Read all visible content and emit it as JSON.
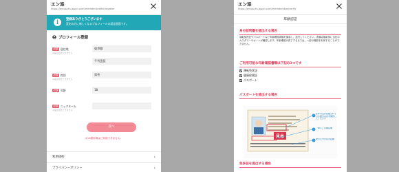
{
  "left_phone": {
    "header": {
      "title": "エン派",
      "url": "https://enjob.en-japan.com/member/profile/register"
    },
    "notice": {
      "title": "登録ありがとうございます",
      "body": "変化の方に新しくなるプロフィールの設定画面です。"
    },
    "section_title": "プロフィール登録",
    "fields": [
      {
        "required": "必須",
        "label": "居住地",
        "sub": "※設定変更できません",
        "values": [
          "東京都",
          "千代田区"
        ]
      },
      {
        "required": "必須",
        "label": "性別",
        "sub": "※設定変更できません",
        "values": [
          "男性"
        ]
      },
      {
        "required": "必須",
        "label": "年齢",
        "sub": "",
        "values": [
          "18"
        ]
      },
      {
        "required": "必須",
        "label": "ニックネーム",
        "sub": "※設定変更できません",
        "values": [
          ""
        ]
      }
    ],
    "submit_label": "次へ",
    "note": "※18歳未満はご利用できません。",
    "footer": [
      {
        "label": "利用規約",
        "chevron": "›"
      },
      {
        "label": "プライバシーポリシー",
        "chevron": "›"
      }
    ]
  },
  "right_phone": {
    "header": {
      "title": "エン派",
      "url": "https://enjob.en-japan.com/member/age/verify"
    },
    "page_title": "年齢認証",
    "section1": {
      "heading": "身分証明書を提出する場合",
      "body": "運転免許証やパスポートなど年齢確認書類を撮影し、送付してください。書類は撮影後に当社のカスタマーサポートが確認します。年齢確認が完了するまでは、一部の機能を利用することができません。"
    },
    "section2": {
      "heading": "ご利用可能な年齢確認書類は下記の3つです",
      "items": [
        "運転免許証",
        "健康保険証",
        "パスポート"
      ]
    },
    "section3": {
      "heading": "パスポートを提出する場合",
      "callouts": [
        "生年月日が記載されている部分は必ず撮影してください",
        "「本人」の署名欄",
        "発行元や氏名の記載"
      ],
      "stamp": "見本"
    },
    "section4": {
      "heading": "免許証を提出する場合"
    }
  },
  "colors": {
    "accent_pink": "#e03d5a",
    "teal": "#22a7b6",
    "button_pink": "#f28a95"
  },
  "icons": [
    "close-icon",
    "info-icon",
    "person-icon",
    "chevron-right-icon",
    "checkbox-icon"
  ]
}
